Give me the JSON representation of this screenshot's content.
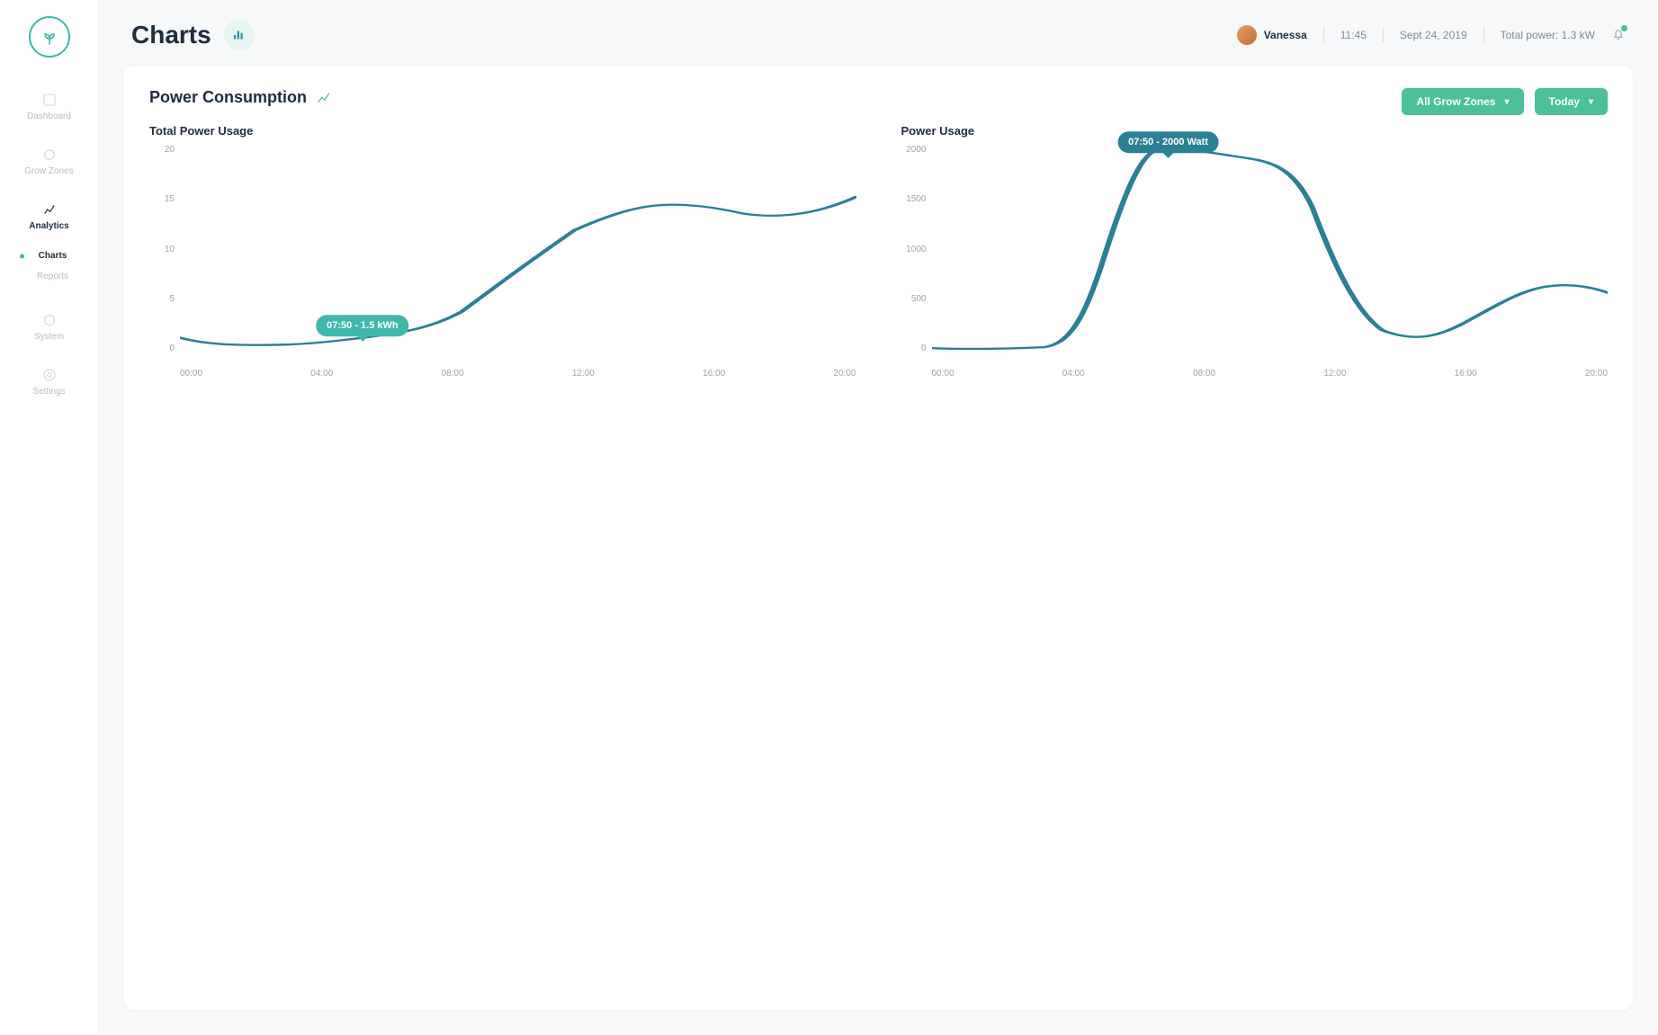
{
  "sidebar": {
    "items": [
      {
        "label": "Dashboard"
      },
      {
        "label": "Grow Zones"
      },
      {
        "label": "Analytics"
      },
      {
        "label": "System"
      },
      {
        "label": "Settings"
      }
    ],
    "sub_items": [
      {
        "label": "Charts"
      },
      {
        "label": "Reports"
      }
    ]
  },
  "header": {
    "page_title": "Charts",
    "user_name": "Vanessa",
    "time": "11:45",
    "date": "Sept 24, 2019",
    "total_power": "Total power: 1.3 kW"
  },
  "panel": {
    "title": "Power Consumption",
    "filter_zone": "All Grow Zones",
    "filter_range": "Today"
  },
  "chart1": {
    "title": "Total Power Usage",
    "tooltip": "07:50 - 1.5 kWh"
  },
  "chart2": {
    "title": "Power Usage",
    "tooltip": "07:50 - 2000 Watt"
  },
  "chart_data": [
    {
      "type": "line",
      "title": "Total Power Usage",
      "xlabel": "",
      "ylabel": "",
      "ylim": [
        0,
        20
      ],
      "x_ticks": [
        "00:00",
        "04:00",
        "08:00",
        "12:00",
        "16:00",
        "20:00"
      ],
      "y_ticks": [
        0,
        5,
        10,
        15,
        20
      ],
      "series": [
        {
          "name": "Total Power Usage (kWh)",
          "x": [
            "00:00",
            "02:00",
            "04:00",
            "06:00",
            "07:50",
            "10:00",
            "12:00",
            "14:00",
            "16:00",
            "18:00",
            "20:00",
            "22:00",
            "24:00"
          ],
          "values": [
            1.5,
            0.8,
            0.6,
            1.0,
            1.5,
            3.0,
            10.0,
            14.0,
            14.5,
            14.0,
            13.0,
            13.5,
            15.0
          ]
        }
      ],
      "annotations": [
        {
          "x": "07:50",
          "y": 1.5,
          "label": "07:50 - 1.5 kWh"
        }
      ]
    },
    {
      "type": "line",
      "title": "Power Usage",
      "xlabel": "",
      "ylabel": "",
      "ylim": [
        0,
        2000
      ],
      "x_ticks": [
        "00:00",
        "04:00",
        "08:00",
        "12:00",
        "16:00",
        "20:00"
      ],
      "y_ticks": [
        0,
        500,
        1000,
        1500,
        2000
      ],
      "series": [
        {
          "name": "Power Usage (Watt)",
          "x": [
            "00:00",
            "02:00",
            "04:00",
            "06:00",
            "07:50",
            "09:00",
            "10:00",
            "12:00",
            "14:00",
            "16:00",
            "18:00",
            "20:00",
            "22:00",
            "24:00"
          ],
          "values": [
            50,
            40,
            60,
            600,
            2000,
            1950,
            1900,
            1850,
            700,
            250,
            300,
            600,
            700,
            650
          ]
        }
      ],
      "annotations": [
        {
          "x": "07:50",
          "y": 2000,
          "label": "07:50 - 2000 Watt"
        }
      ]
    }
  ]
}
